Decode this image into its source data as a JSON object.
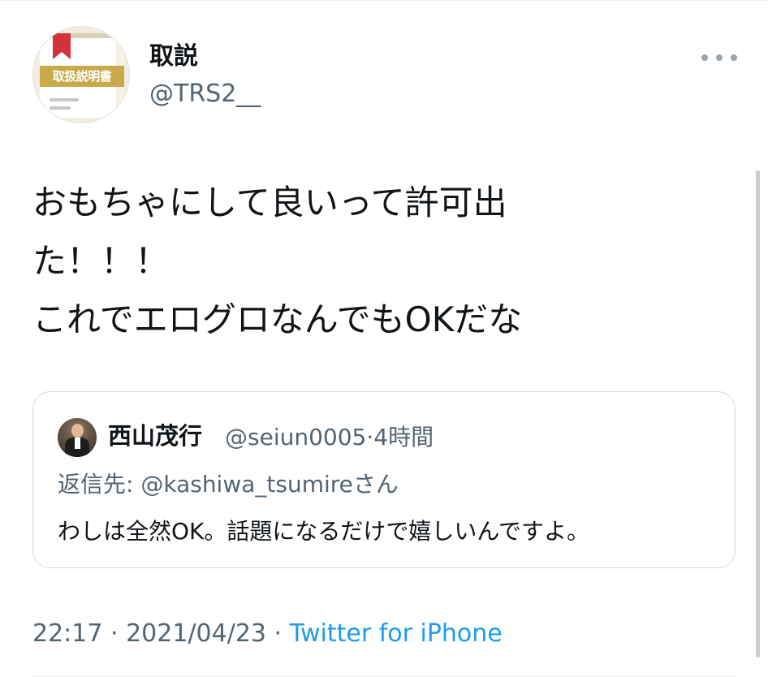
{
  "author": {
    "display_name": "取説",
    "handle": "@TRS2__",
    "avatar_label": "取扱説明書"
  },
  "tweet": {
    "text": "おもちゃにして良いって許可出\nた！！！\nこれでエログロなんでもOKだな"
  },
  "quoted_tweet": {
    "display_name": "西山茂行",
    "handle": "@seiun0005",
    "separator": "·",
    "time": "4時間",
    "reply_prefix": "返信先: ",
    "reply_to": "@kashiwa_tsumire",
    "reply_suffix": "さん",
    "text": "わしは全然OK。話題になるだけで嬉しいんですよ。"
  },
  "footer": {
    "time": "22:17",
    "separator": " · ",
    "date": "2021/04/23",
    "source": "Twitter for iPhone"
  },
  "icons": {
    "more": "more-horizontal-icon"
  },
  "colors": {
    "text": "#0f1419",
    "secondary": "#536471",
    "link": "#1d9bf0",
    "border": "#cfd9de"
  }
}
